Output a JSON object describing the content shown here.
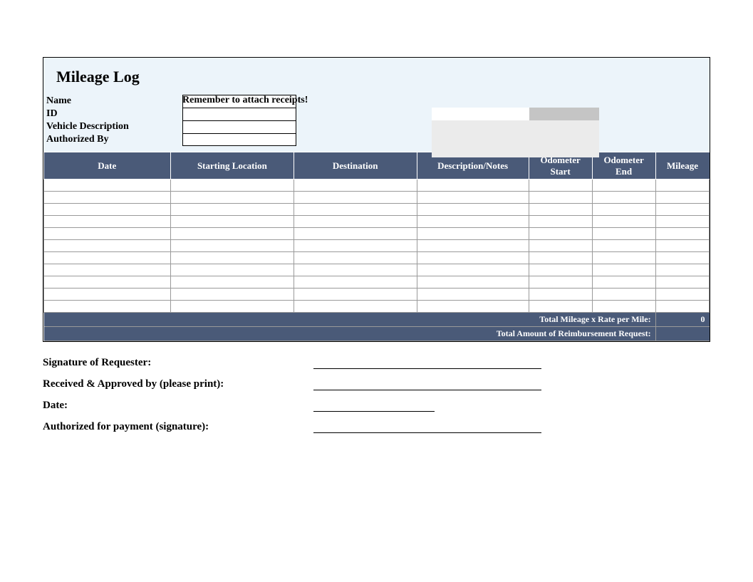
{
  "title": "Mileage Log",
  "reminder": "Remember to attach receipts!",
  "info_labels": {
    "name": "Name",
    "id": "ID",
    "vehicle": "Vehicle Description",
    "authorized": "Authorized By"
  },
  "columns": {
    "date": "Date",
    "start_loc": "Starting Location",
    "destination": "Destination",
    "description": "Description/Notes",
    "odo_start": "Odometer Start",
    "odo_end": "Odometer End",
    "mileage": "Mileage"
  },
  "rows": [
    "",
    "",
    "",
    "",
    "",
    "",
    "",
    "",
    "",
    "",
    ""
  ],
  "footer": {
    "total_rate_label": "Total Mileage x Rate per Mile:",
    "total_rate_value": "0",
    "reimbursement_label": "Total Amount of Reimbursement Request:",
    "reimbursement_value": ""
  },
  "signatures": {
    "requester": "Signature of Requester:",
    "approved": "Received & Approved by (please print):",
    "date": "Date:",
    "payment": "Authorized for payment (signature):"
  }
}
